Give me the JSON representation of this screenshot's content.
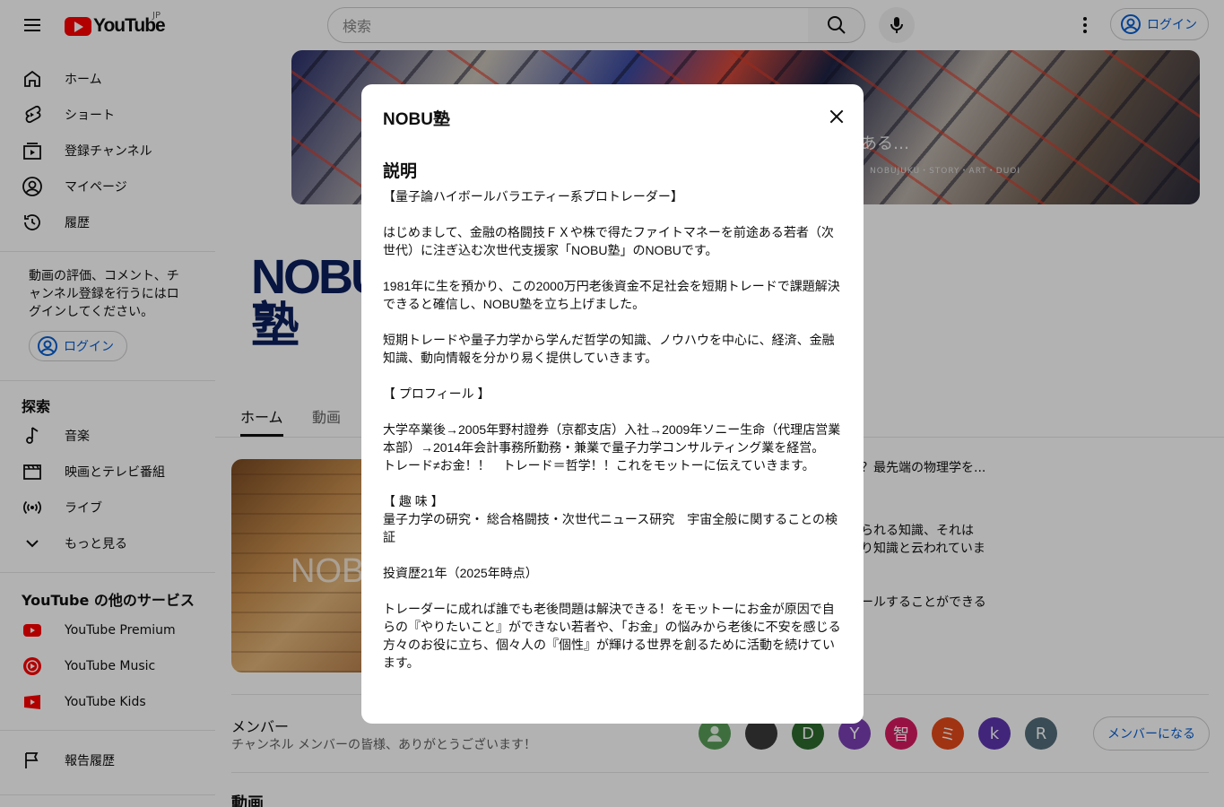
{
  "header": {
    "logo_text": "YouTube",
    "logo_region": "JP",
    "search_placeholder": "検索",
    "login_label": "ログイン"
  },
  "sidebar": {
    "main_items": [
      {
        "label": "ホーム",
        "icon": "home-icon"
      },
      {
        "label": "ショート",
        "icon": "shorts-icon"
      },
      {
        "label": "登録チャンネル",
        "icon": "subscriptions-icon"
      },
      {
        "label": "マイページ",
        "icon": "account-icon"
      },
      {
        "label": "履歴",
        "icon": "history-icon"
      }
    ],
    "signin_message": "動画の評価、コメント、チャンネル登録を行うにはログインしてください。",
    "signin_label": "ログイン",
    "explore_heading": "探索",
    "explore_items": [
      {
        "label": "音楽",
        "icon": "music-icon"
      },
      {
        "label": "映画とテレビ番組",
        "icon": "film-icon"
      },
      {
        "label": "ライブ",
        "icon": "live-icon"
      },
      {
        "label": "もっと見る",
        "icon": "chevron-down-icon"
      }
    ],
    "services_heading": "YouTube の他のサービス",
    "services_items": [
      {
        "label": "YouTube Premium",
        "icon": "youtube-premium-icon"
      },
      {
        "label": "YouTube Music",
        "icon": "youtube-music-icon"
      },
      {
        "label": "YouTube Kids",
        "icon": "youtube-kids-icon"
      }
    ],
    "report_label": "報告履歴"
  },
  "channel": {
    "banner_text": "ある…",
    "banner_subtext": "NOBUJUKU・STORY・ART・DUOI",
    "avatar_text": "NOBU塾",
    "tabs": [
      "ホーム",
      "動画"
    ],
    "featured_thumb_text": "NOB",
    "featured_desc": [
      "？最先端の物理学を...",
      "られる知識、それは",
      "り知識と云われていま",
      "ールすることができる"
    ],
    "members_title": "メンバー",
    "members_sub": "チャンネル メンバーの皆様、ありがとうございます！",
    "member_avatars": [
      {
        "letter": "",
        "color": "#5a9e5a"
      },
      {
        "letter": "",
        "color": "#444444"
      },
      {
        "letter": "D",
        "color": "#2e6b2e"
      },
      {
        "letter": "Y",
        "color": "#7b3fb5"
      },
      {
        "letter": "智",
        "color": "#d81b60"
      },
      {
        "letter": "ミ",
        "color": "#e64a19"
      },
      {
        "letter": "k",
        "color": "#5e35b1"
      },
      {
        "letter": "R",
        "color": "#546e7a"
      }
    ],
    "member_button": "メンバーになる",
    "videos_title": "動画"
  },
  "dialog": {
    "title": "NOBU塾",
    "heading": "説明",
    "body": "【量子論ハイボールバラエティー系プロトレーダー】\n\nはじめまして、金融の格闘技ＦＸや株で得たファイトマネーを前途ある若者（次世代）に注ぎ込む次世代支援家「NOBU塾」のNOBUです。\n\n1981年に生を預かり、この2000万円老後資金不足社会を短期トレードで課題解決できると確信し、NOBU塾を立ち上げました。\n\n短期トレードや量子力学から学んだ哲学の知識、ノウハウを中心に、経済、金融知識、動向情報を分かり易く提供していきます。\n\n【 プロフィール 】\n\n大学卒業後→2005年野村證券（京都支店）入社→2009年ソニー生命（代理店営業本部）→2014年会計事務所勤務・兼業で量子力学コンサルティング業を経営。\nトレード≠お金！！　トレード＝哲学！！これをモットーに伝えていきます。\n\n【 趣 味 】\n量子力学の研究・ 総合格闘技・次世代ニュース研究　宇宙全般に関することの検証\n\n投資歴21年（2025年時点）\n\nトレーダーに成れば誰でも老後問題は解決できる！をモットーにお金が原因で自らの『やりたいこと』ができない若者や、「お金」の悩みから老後に不安を感じる方々のお役に立ち、個々人の『個性』が輝ける世界を創るために活動を続けています。"
  }
}
